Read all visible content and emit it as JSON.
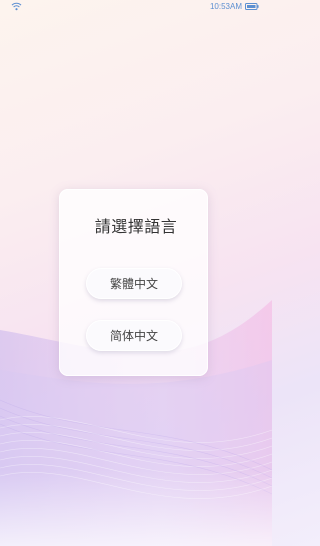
{
  "status_bar": {
    "time": "10:53AM",
    "wifi_icon": "wifi-icon",
    "battery_icon": "battery-icon",
    "accent_color": "#5c8fd1"
  },
  "dialog": {
    "title": "請選擇語言",
    "options": [
      {
        "label": "繁體中文"
      },
      {
        "label": "简体中文"
      }
    ]
  }
}
